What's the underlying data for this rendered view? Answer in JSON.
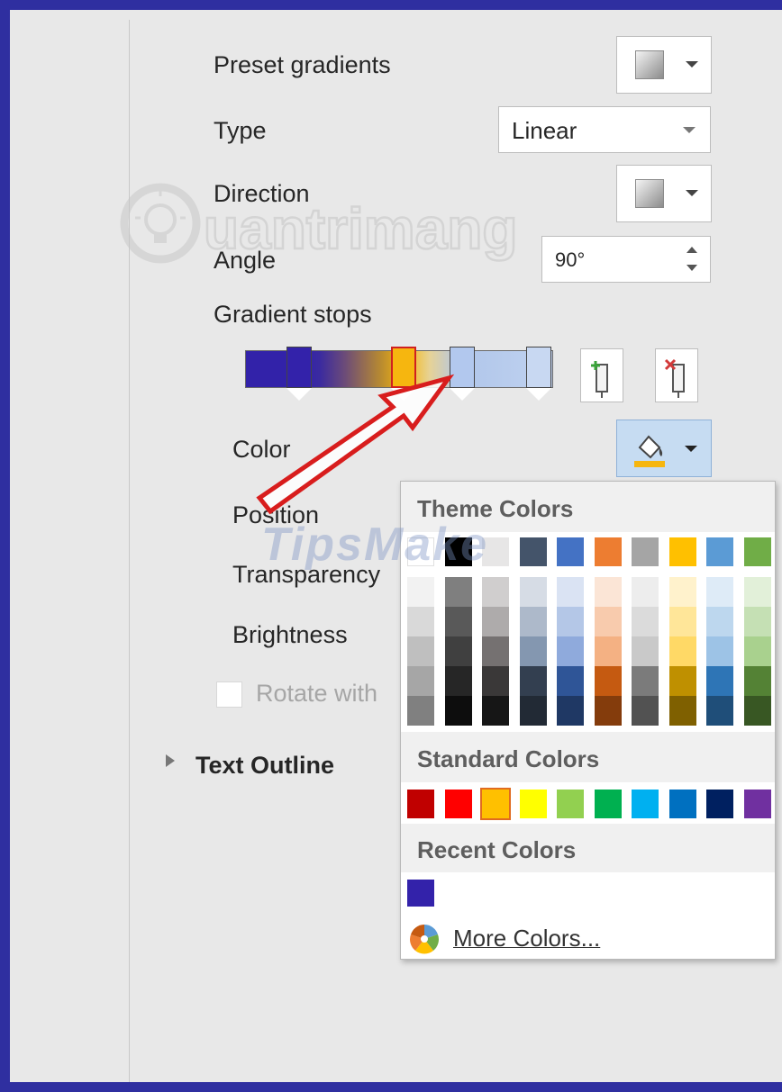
{
  "panel": {
    "preset_label": "Preset gradients",
    "type_label": "Type",
    "type_value": "Linear",
    "direction_label": "Direction",
    "angle_label": "Angle",
    "angle_value": "90°",
    "gradient_stops_label": "Gradient stops",
    "color_label": "Color",
    "position_label": "Position",
    "transparency_label": "Transparency",
    "brightness_label": "Brightness",
    "rotate_label": "Rotate with",
    "text_outline_label": "Text Outline"
  },
  "gradient_stops": [
    {
      "color": "#3322aa",
      "selected": false
    },
    {
      "color": "#f6b60f",
      "selected": true
    },
    {
      "color": "#b2c8ee",
      "selected": false
    },
    {
      "color": "#c8d8f2",
      "selected": false
    }
  ],
  "watermarks": [
    "uantrimang",
    "TipsMake"
  ],
  "color_picker": {
    "theme_title": "Theme Colors",
    "standard_title": "Standard Colors",
    "recent_title": "Recent Colors",
    "more_colors": "More Colors...",
    "theme_top": [
      "#ffffff",
      "#000000",
      "#e7e6e6",
      "#44546a",
      "#4472c4",
      "#ed7d31",
      "#a5a5a5",
      "#ffc000",
      "#5b9bd5",
      "#70ad47"
    ],
    "theme_shades": [
      [
        "#f2f2f2",
        "#d9d9d9",
        "#bfbfbf",
        "#a6a6a6",
        "#808080"
      ],
      [
        "#7f7f7f",
        "#595959",
        "#404040",
        "#262626",
        "#0d0d0d"
      ],
      [
        "#d0cece",
        "#aeabab",
        "#757171",
        "#3a3838",
        "#161616"
      ],
      [
        "#d6dce5",
        "#adb9ca",
        "#8497b0",
        "#333f50",
        "#222a35"
      ],
      [
        "#dae3f3",
        "#b4c7e7",
        "#8faadc",
        "#2f5597",
        "#1f3864"
      ],
      [
        "#fbe5d6",
        "#f8cbad",
        "#f4b183",
        "#c55a11",
        "#843c0c"
      ],
      [
        "#ededed",
        "#dbdbdb",
        "#c9c9c9",
        "#7b7b7b",
        "#525252"
      ],
      [
        "#fff2cc",
        "#ffe699",
        "#ffd966",
        "#bf9000",
        "#7f6000"
      ],
      [
        "#deebf7",
        "#bdd7ee",
        "#9dc3e6",
        "#2e75b6",
        "#1f4e79"
      ],
      [
        "#e2f0d9",
        "#c5e0b4",
        "#a9d18e",
        "#548235",
        "#385723"
      ]
    ],
    "standard": [
      "#c00000",
      "#ff0000",
      "#ffc000",
      "#ffff00",
      "#92d050",
      "#00b050",
      "#00b0f0",
      "#0070c0",
      "#002060",
      "#7030a0"
    ],
    "standard_selected_index": 2,
    "recent": [
      "#3322aa"
    ]
  },
  "icons": {
    "add_stop": "add-gradient-stop-icon",
    "remove_stop": "remove-gradient-stop-icon",
    "paint_bucket": "paint-bucket-icon",
    "more_colors": "color-wheel-icon"
  }
}
